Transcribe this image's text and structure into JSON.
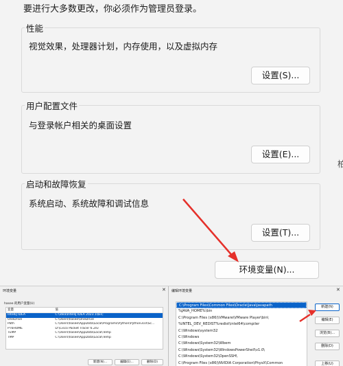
{
  "top_note": "要进行大多数更改，你必须作为管理员登录。",
  "performance": {
    "title": "性能",
    "desc": "视觉效果，处理器计划，内存使用，以及虚拟内存",
    "button": "设置(S)..."
  },
  "user_profiles": {
    "title": "用户配置文件",
    "desc": "与登录帐户相关的桌面设置",
    "button": "设置(E)..."
  },
  "startup_recovery": {
    "title": "启动和故障恢复",
    "desc": "系统启动、系统故障和调试信息",
    "button": "设置(T)..."
  },
  "env_button": "环境变量(N)...",
  "right_edge_char": "柏",
  "env_dialog": {
    "title": "环境变量",
    "close": "✕",
    "user_vars_label": "hasee 的用户变量(U)",
    "columns": [
      "变量",
      "值"
    ],
    "rows": [
      {
        "name": "IntelliJ IDEA",
        "value": "C:\\idea\\IntelliJ IDEA 2023.1\\bin;"
      },
      {
        "name": "OneDrive",
        "value": "C:\\Users\\hasee\\OneDrive"
      },
      {
        "name": "Path",
        "value": "C:\\Users\\hasee\\AppData\\Local\\Programs\\Python\\Python310\\Sc..."
      },
      {
        "name": "PT6HOME",
        "value": "D:\\Cisco Packet Tracer 6.2sv"
      },
      {
        "name": "TEMP",
        "value": "C:\\Users\\hasee\\AppData\\Local\\Temp"
      },
      {
        "name": "TMP",
        "value": "C:\\Users\\hasee\\AppData\\Local\\Temp"
      }
    ],
    "buttons": [
      "新建(N)...",
      "编辑(E)...",
      "删除(D)"
    ]
  },
  "edit_dialog": {
    "title": "编辑环境变量",
    "close": "✕",
    "paths": [
      "C:\\Program Files\\Common Files\\Oracle\\Java\\javapath",
      "%JAVA_HOME%\\bin",
      "C:\\Program Files (x86)\\VMware\\VMware Player\\bin\\",
      "%INTEL_DEV_REDIST%redist\\intel64\\compiler",
      "C:\\Windows\\system32",
      "C:\\Windows",
      "C:\\Windows\\System32\\Wbem",
      "C:\\Windows\\System32\\WindowsPowerShell\\v1.0\\",
      "C:\\Windows\\System32\\OpenSSH\\",
      "C:\\Program Files (x86)\\NVIDIA Corporation\\PhysX\\Common"
    ],
    "buttons": [
      "新建(N)",
      "编辑(E)",
      "浏览(B)...",
      "删除(D)",
      "上移(U)"
    ]
  },
  "colors": {
    "arrow": "#e5302a",
    "selection": "#0a63c9"
  }
}
